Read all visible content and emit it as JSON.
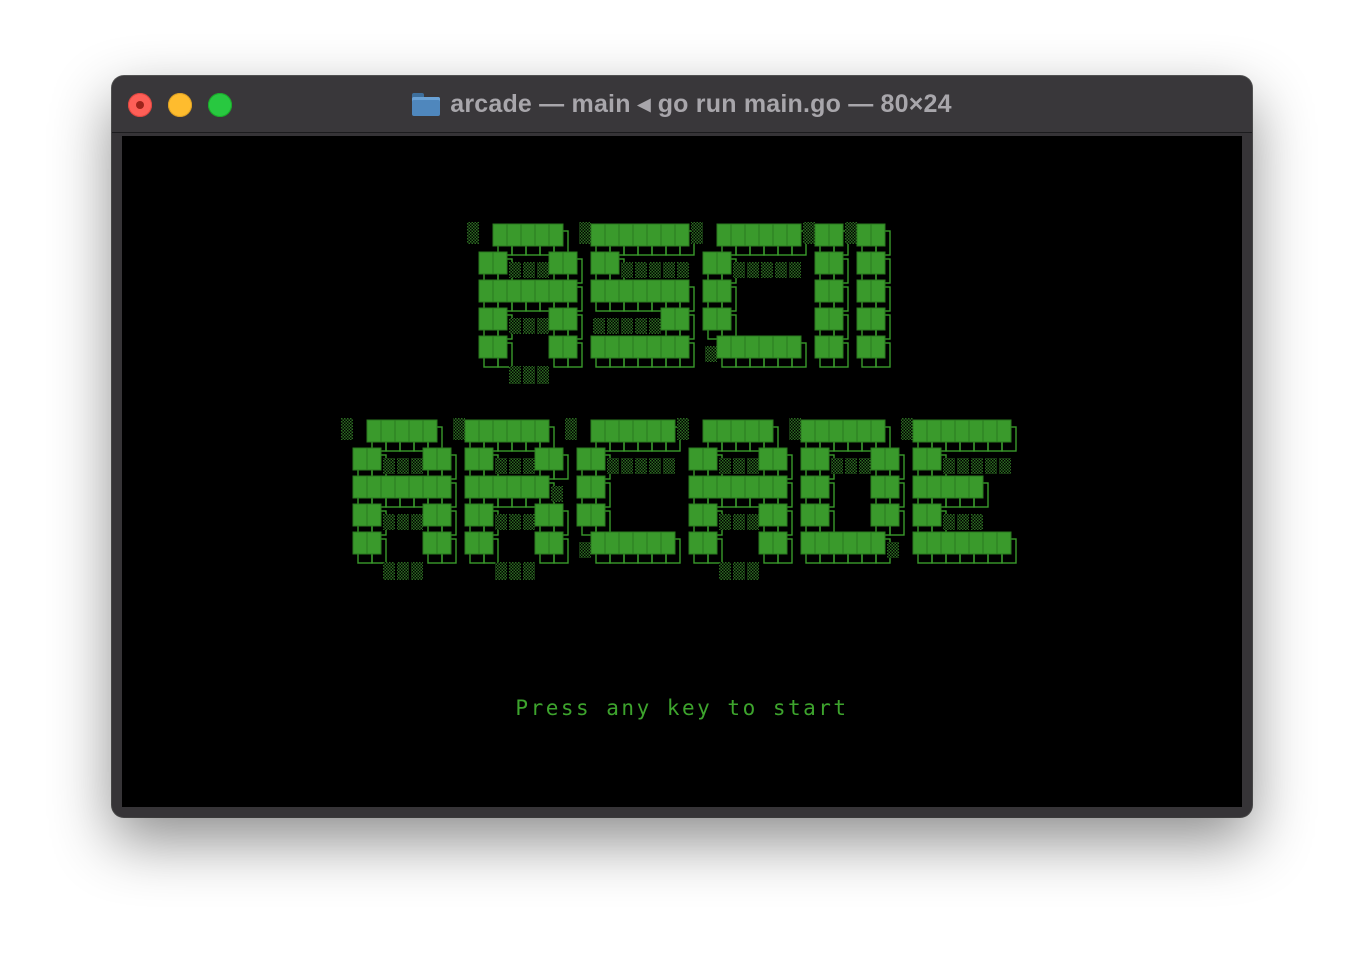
{
  "window": {
    "title": "arcade — main ◂ go run main.go — 80×24",
    "folder_icon": "folder-icon",
    "controls": {
      "close_icon": "close-icon",
      "minimize_icon": "minimize-icon",
      "zoom_icon": "zoom-icon"
    }
  },
  "terminal": {
    "art_lines": [
      "ASCII",
      "ARCADE"
    ],
    "prompt": "Press any key to start"
  },
  "colors": {
    "fill": "#3a9a2c",
    "fill_edge": "#2b7a20",
    "outline": "#3a9a2c",
    "shade": "#2c6d22",
    "prompt": "#3da42d",
    "background": "#000000"
  }
}
